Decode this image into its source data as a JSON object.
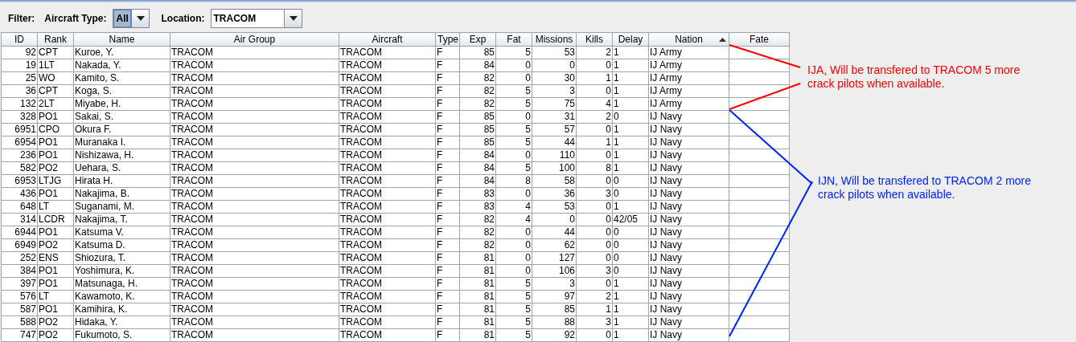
{
  "filter": {
    "label": "Filter:",
    "aircraft_type": {
      "label": "Aircraft Type:",
      "value": "All",
      "focused": true
    },
    "location": {
      "label": "Location:",
      "value": "TRACOM",
      "focused": false
    }
  },
  "columns": [
    {
      "label": "ID",
      "kind": "number",
      "sorted": false
    },
    {
      "label": "Rank",
      "kind": "text",
      "sorted": false
    },
    {
      "label": "Name",
      "kind": "text",
      "sorted": false
    },
    {
      "label": "Air Group",
      "kind": "text",
      "sorted": false
    },
    {
      "label": "Aircraft",
      "kind": "text",
      "sorted": false
    },
    {
      "label": "Type",
      "kind": "text",
      "sorted": false
    },
    {
      "label": "Exp",
      "kind": "number",
      "sorted": false
    },
    {
      "label": "Fat",
      "kind": "number",
      "sorted": false
    },
    {
      "label": "Missions",
      "kind": "number",
      "sorted": false
    },
    {
      "label": "Kills",
      "kind": "number",
      "sorted": false
    },
    {
      "label": "Delay",
      "kind": "text",
      "sorted": false
    },
    {
      "label": "Nation",
      "kind": "text",
      "sorted": true
    },
    {
      "label": "Fate",
      "kind": "text",
      "sorted": false
    }
  ],
  "rows": [
    [
      "92",
      "CPT",
      "Kuroe, Y.",
      "TRACOM",
      "TRACOM",
      "F",
      "85",
      "5",
      "53",
      "2",
      "1",
      "IJ Army"
    ],
    [
      "19",
      "1LT",
      "Nakada, Y.",
      "TRACOM",
      "TRACOM",
      "F",
      "84",
      "0",
      "0",
      "0",
      "1",
      "IJ Army"
    ],
    [
      "25",
      "WO",
      "Kamito, S.",
      "TRACOM",
      "TRACOM",
      "F",
      "82",
      "0",
      "30",
      "1",
      "1",
      "IJ Army"
    ],
    [
      "36",
      "CPT",
      "Koga, S.",
      "TRACOM",
      "TRACOM",
      "F",
      "82",
      "5",
      "3",
      "0",
      "1",
      "IJ Army"
    ],
    [
      "132",
      "2LT",
      "Miyabe, H.",
      "TRACOM",
      "TRACOM",
      "F",
      "82",
      "5",
      "75",
      "4",
      "1",
      "IJ Army"
    ],
    [
      "328",
      "PO1",
      "Sakai, S.",
      "TRACOM",
      "TRACOM",
      "F",
      "85",
      "0",
      "31",
      "2",
      "0",
      "IJ Navy"
    ],
    [
      "6951",
      "CPO",
      "Okura F.",
      "TRACOM",
      "TRACOM",
      "F",
      "85",
      "5",
      "57",
      "0",
      "1",
      "IJ Navy"
    ],
    [
      "6954",
      "PO1",
      "Muranaka I.",
      "TRACOM",
      "TRACOM",
      "F",
      "85",
      "5",
      "44",
      "1",
      "1",
      "IJ Navy"
    ],
    [
      "236",
      "PO1",
      "Nishizawa, H.",
      "TRACOM",
      "TRACOM",
      "F",
      "84",
      "0",
      "110",
      "0",
      "1",
      "IJ Navy"
    ],
    [
      "582",
      "PO2",
      "Uehara, S.",
      "TRACOM",
      "TRACOM",
      "F",
      "84",
      "5",
      "100",
      "8",
      "1",
      "IJ Navy"
    ],
    [
      "6953",
      "LTJG",
      "Hirata H.",
      "TRACOM",
      "TRACOM",
      "F",
      "84",
      "8",
      "58",
      "0",
      "0",
      "IJ Navy"
    ],
    [
      "436",
      "PO1",
      "Nakajima, B.",
      "TRACOM",
      "TRACOM",
      "F",
      "83",
      "0",
      "36",
      "3",
      "0",
      "IJ Navy"
    ],
    [
      "648",
      "LT",
      "Suganami, M.",
      "TRACOM",
      "TRACOM",
      "F",
      "83",
      "4",
      "53",
      "0",
      "1",
      "IJ Navy"
    ],
    [
      "314",
      "LCDR",
      "Nakajima, T.",
      "TRACOM",
      "TRACOM",
      "F",
      "82",
      "4",
      "0",
      "0",
      "42/05",
      "IJ Navy"
    ],
    [
      "6944",
      "PO1",
      "Katsuma V.",
      "TRACOM",
      "TRACOM",
      "F",
      "82",
      "0",
      "44",
      "0",
      "0",
      "IJ Navy"
    ],
    [
      "6949",
      "PO2",
      "Katsuma D.",
      "TRACOM",
      "TRACOM",
      "F",
      "82",
      "0",
      "62",
      "0",
      "0",
      "IJ Navy"
    ],
    [
      "252",
      "ENS",
      "Shiozura, T.",
      "TRACOM",
      "TRACOM",
      "F",
      "81",
      "0",
      "127",
      "0",
      "0",
      "IJ Navy"
    ],
    [
      "384",
      "PO1",
      "Yoshimura, K.",
      "TRACOM",
      "TRACOM",
      "F",
      "81",
      "0",
      "106",
      "3",
      "0",
      "IJ Navy"
    ],
    [
      "397",
      "PO1",
      "Matsunaga, H.",
      "TRACOM",
      "TRACOM",
      "F",
      "81",
      "5",
      "3",
      "0",
      "1",
      "IJ Navy"
    ],
    [
      "576",
      "LT",
      "Kawamoto, K.",
      "TRACOM",
      "TRACOM",
      "F",
      "81",
      "5",
      "97",
      "2",
      "1",
      "IJ Navy"
    ],
    [
      "587",
      "PO1",
      "Kamihira, K.",
      "TRACOM",
      "TRACOM",
      "F",
      "81",
      "5",
      "85",
      "1",
      "1",
      "IJ Navy"
    ],
    [
      "588",
      "PO2",
      "Hidaka, Y.",
      "TRACOM",
      "TRACOM",
      "F",
      "81",
      "5",
      "88",
      "3",
      "1",
      "IJ Navy"
    ],
    [
      "747",
      "PO2",
      "Fukumoto, S.",
      "TRACOM",
      "TRACOM",
      "F",
      "81",
      "5",
      "92",
      "0",
      "1",
      "IJ Navy"
    ]
  ],
  "notes": [
    {
      "text": "IJA, Will be transfered to TRACOM 5 more crack pilots when available.",
      "color": "#ff0000"
    },
    {
      "text": "IJN, Will be transfered to TRACOM 2 more crack pilots when available.",
      "color": "#0022ff"
    }
  ]
}
